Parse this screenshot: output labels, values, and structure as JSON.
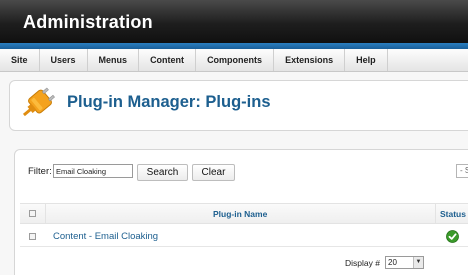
{
  "app": {
    "title": "Administration"
  },
  "menu": {
    "items": [
      {
        "label": "Site"
      },
      {
        "label": "Users"
      },
      {
        "label": "Menus"
      },
      {
        "label": "Content"
      },
      {
        "label": "Components"
      },
      {
        "label": "Extensions"
      },
      {
        "label": "Help"
      }
    ]
  },
  "page": {
    "title": "Plug-in Manager: Plug-ins",
    "icon": "plug-icon"
  },
  "filter": {
    "label": "Filter:",
    "value": "Email Cloaking",
    "search_label": "Search",
    "clear_label": "Clear",
    "select_stub": "- S"
  },
  "table": {
    "columns": {
      "name": "Plug-in Name",
      "status": "Status"
    },
    "rows": [
      {
        "name": "Content - Email Cloaking",
        "status_icon": "enabled-check-icon"
      }
    ]
  },
  "footer": {
    "display_label": "Display #",
    "display_value": "20"
  },
  "colors": {
    "accent": "#1d5f8f",
    "banner": "#1e1e1e",
    "strip": "#2a7fc0",
    "enabled": "#3a9a2a",
    "icon_orange": "#f4a21d"
  }
}
